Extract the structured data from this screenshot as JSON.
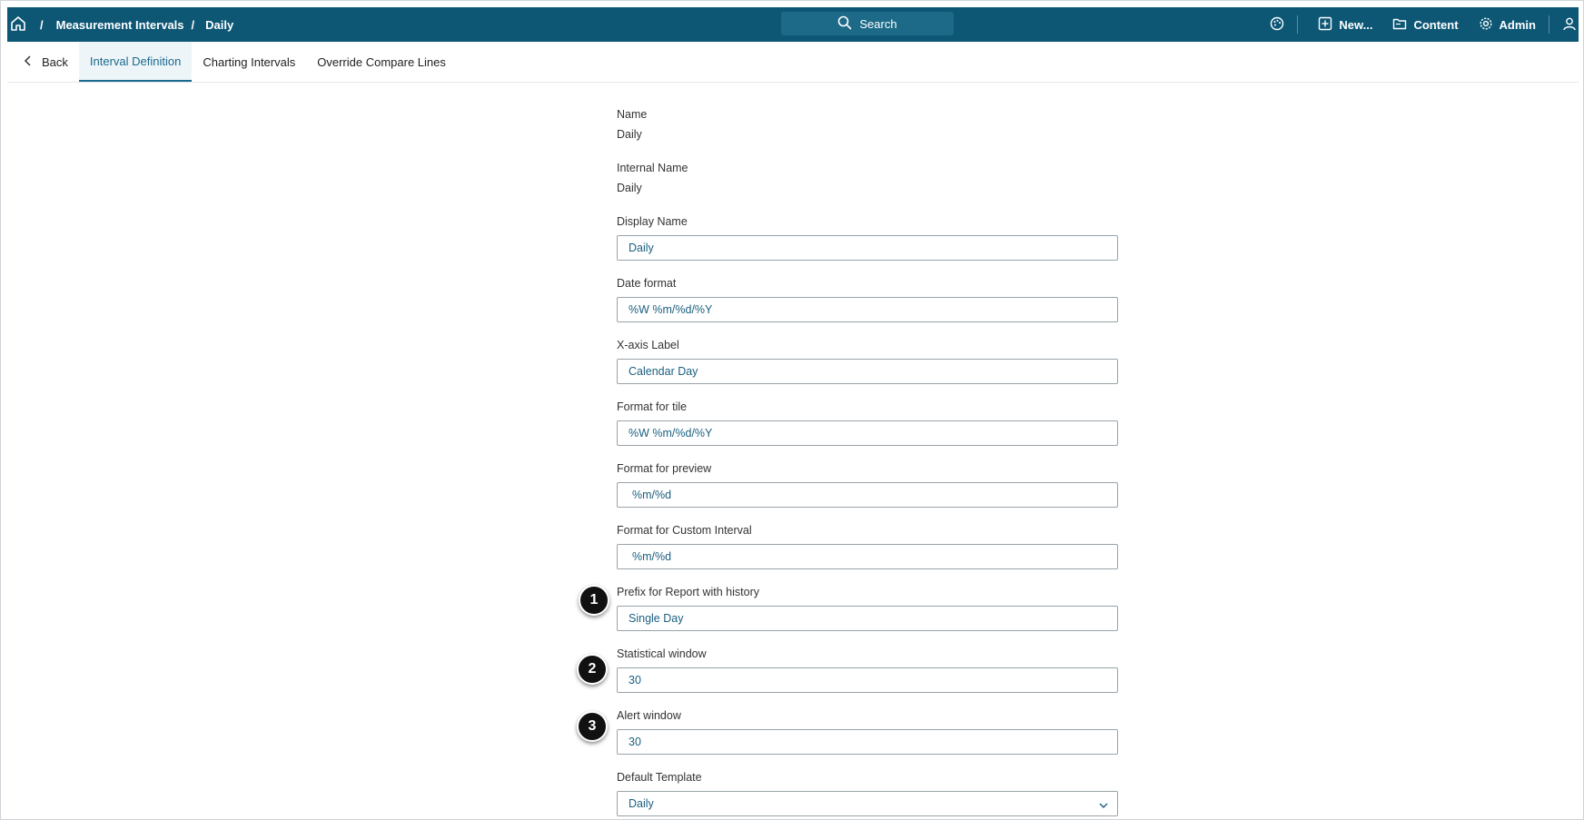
{
  "breadcrumb": {
    "sep": "/",
    "items": [
      "Measurement Intervals",
      "Daily"
    ]
  },
  "search": {
    "label": "Search"
  },
  "toolbar": {
    "new_label": "New...",
    "content_label": "Content",
    "admin_label": "Admin"
  },
  "tabs": {
    "back_label": "Back",
    "items": [
      "Interval Definition",
      "Charting Intervals",
      "Override Compare Lines"
    ]
  },
  "form": {
    "name": {
      "label": "Name",
      "value": "Daily"
    },
    "internal_name": {
      "label": "Internal Name",
      "value": "Daily"
    },
    "display_name": {
      "label": "Display Name",
      "value": "Daily"
    },
    "date_format": {
      "label": "Date format",
      "value": "%W %m/%d/%Y"
    },
    "x_axis_label": {
      "label": "X-axis Label",
      "value": "Calendar Day"
    },
    "format_tile": {
      "label": "Format for tile",
      "value": "%W %m/%d/%Y"
    },
    "format_preview": {
      "label": "Format for preview",
      "value": "%m/%d"
    },
    "format_custom": {
      "label": "Format for Custom Interval",
      "value": "%m/%d"
    },
    "prefix_report": {
      "label": "Prefix for Report with history",
      "value": "Single Day"
    },
    "statistical_window": {
      "label": "Statistical window",
      "value": "30"
    },
    "alert_window": {
      "label": "Alert window",
      "value": "30"
    },
    "default_template": {
      "label": "Default Template",
      "value": "Daily"
    }
  },
  "markers": [
    "1",
    "2",
    "3"
  ],
  "colors": {
    "topbar": "#0d5775",
    "accent": "#1a6a8d",
    "field_text": "#1a5f80"
  }
}
